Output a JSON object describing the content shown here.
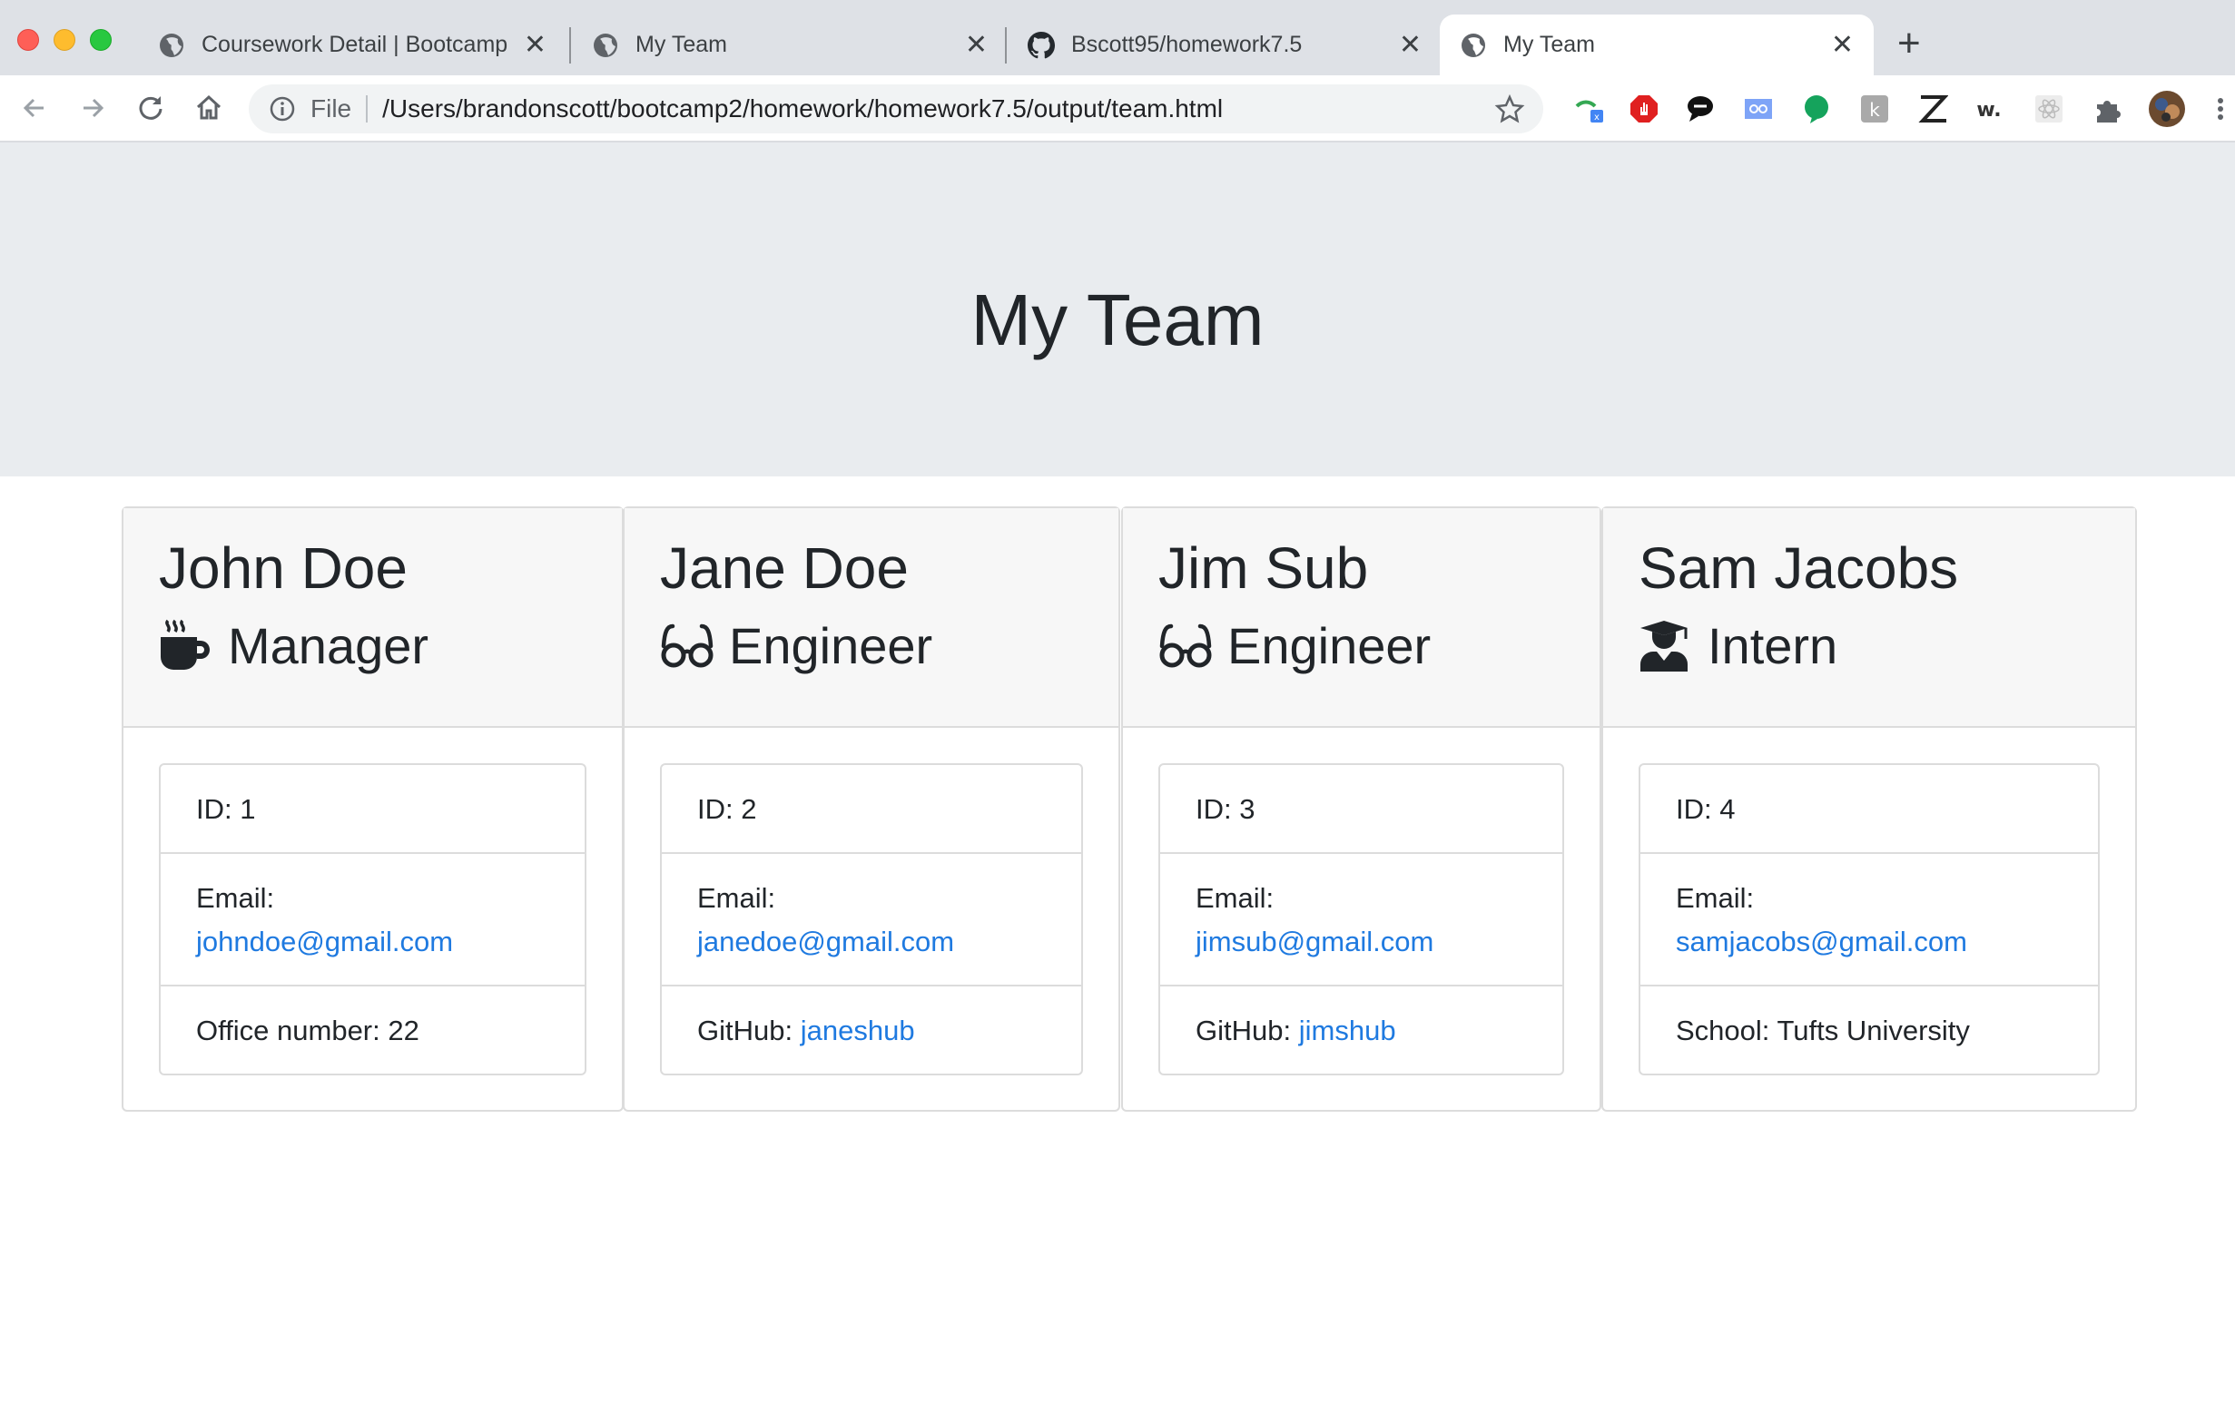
{
  "browser": {
    "tabs": [
      {
        "title": "Coursework Detail | Bootcamp",
        "icon": "globe-icon",
        "active": false
      },
      {
        "title": "My Team",
        "icon": "globe-icon",
        "active": false
      },
      {
        "title": "Bscott95/homework7.5",
        "icon": "github-icon",
        "active": false
      },
      {
        "title": "My Team",
        "icon": "globe-icon",
        "active": true
      }
    ],
    "tab_close": "✕",
    "new_tab": "+",
    "address": {
      "scheme": "File",
      "url": "/Users/brandonscott/bootcamp2/homework/homework7.5/output/team.html"
    }
  },
  "page": {
    "title": "My Team",
    "colors": {
      "jumbotron": "#e9ecef",
      "link": "#1f7ae0"
    },
    "employees": [
      {
        "name": "John Doe",
        "role": "Manager",
        "role_icon": "mug-hot-icon",
        "id_text": "ID: 1",
        "email_label": "Email:",
        "email": "johndoe@gmail.com",
        "extra_label": "Office number: 22",
        "extra_link": ""
      },
      {
        "name": "Jane Doe",
        "role": "Engineer",
        "role_icon": "glasses-icon",
        "id_text": "ID: 2",
        "email_label": "Email:",
        "email": "janedoe@gmail.com",
        "extra_label": "GitHub:",
        "extra_link": "janeshub"
      },
      {
        "name": "Jim Sub",
        "role": "Engineer",
        "role_icon": "glasses-icon",
        "id_text": "ID: 3",
        "email_label": "Email:",
        "email": "jimsub@gmail.com",
        "extra_label": "GitHub:",
        "extra_link": "jimshub"
      },
      {
        "name": "Sam Jacobs",
        "role": "Intern",
        "role_icon": "user-graduate-icon",
        "id_text": "ID: 4",
        "email_label": "Email:",
        "email": "samjacobs@gmail.com",
        "extra_label": "School: Tufts University",
        "extra_link": ""
      }
    ]
  }
}
